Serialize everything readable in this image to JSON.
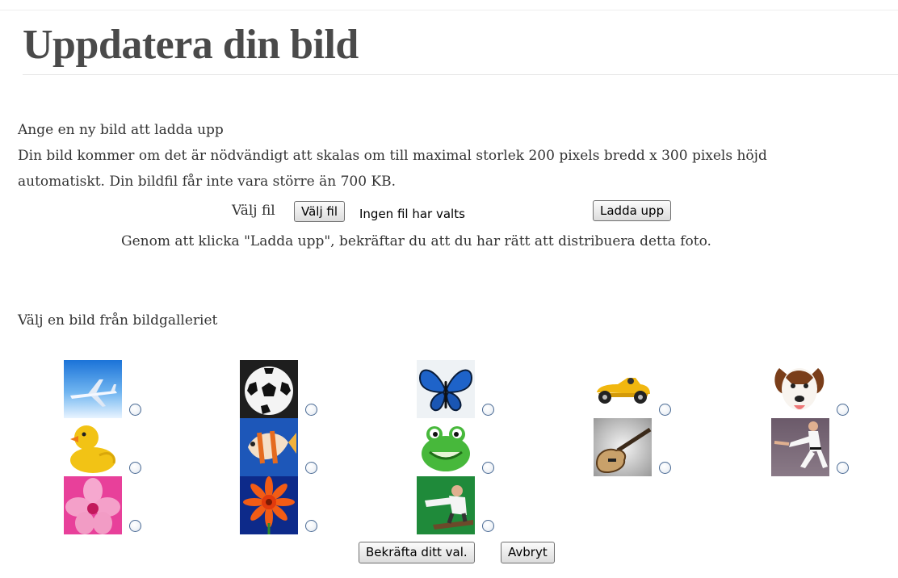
{
  "header": {
    "title": "Uppdatera din bild"
  },
  "upload": {
    "intro": "Ange en ny bild att ladda upp",
    "info_line1": "Din bild kommer om det är nödvändigt att skalas om till maximal storlek 200 pixels bredd x 300 pixels höjd",
    "info_line2": "automatiskt. Din bildfil får inte vara större än 700 KB.",
    "file_label": "Välj fil",
    "file_button": "Välj fil",
    "file_status": "Ingen fil har valts",
    "upload_button": "Ladda upp",
    "consent": "Genom att klicka \"Ladda upp\", bekräftar du att du har rätt att distribuera detta foto."
  },
  "gallery": {
    "heading": "Välj en bild från bildgalleriet",
    "images": [
      {
        "icon": "airplane-icon"
      },
      {
        "icon": "soccer-ball-icon"
      },
      {
        "icon": "butterfly-icon"
      },
      {
        "icon": "toy-car-icon"
      },
      {
        "icon": "dog-icon"
      },
      {
        "icon": "rubber-duck-icon"
      },
      {
        "icon": "fish-icon"
      },
      {
        "icon": "frog-icon"
      },
      {
        "icon": "guitar-icon"
      },
      {
        "icon": "karate-icon"
      },
      {
        "icon": "flower-icon"
      },
      {
        "icon": "gerbera-icon"
      },
      {
        "icon": "skateboarder-icon"
      }
    ],
    "confirm_button": "Bekräfta ditt val.",
    "cancel_button": "Avbryt"
  }
}
